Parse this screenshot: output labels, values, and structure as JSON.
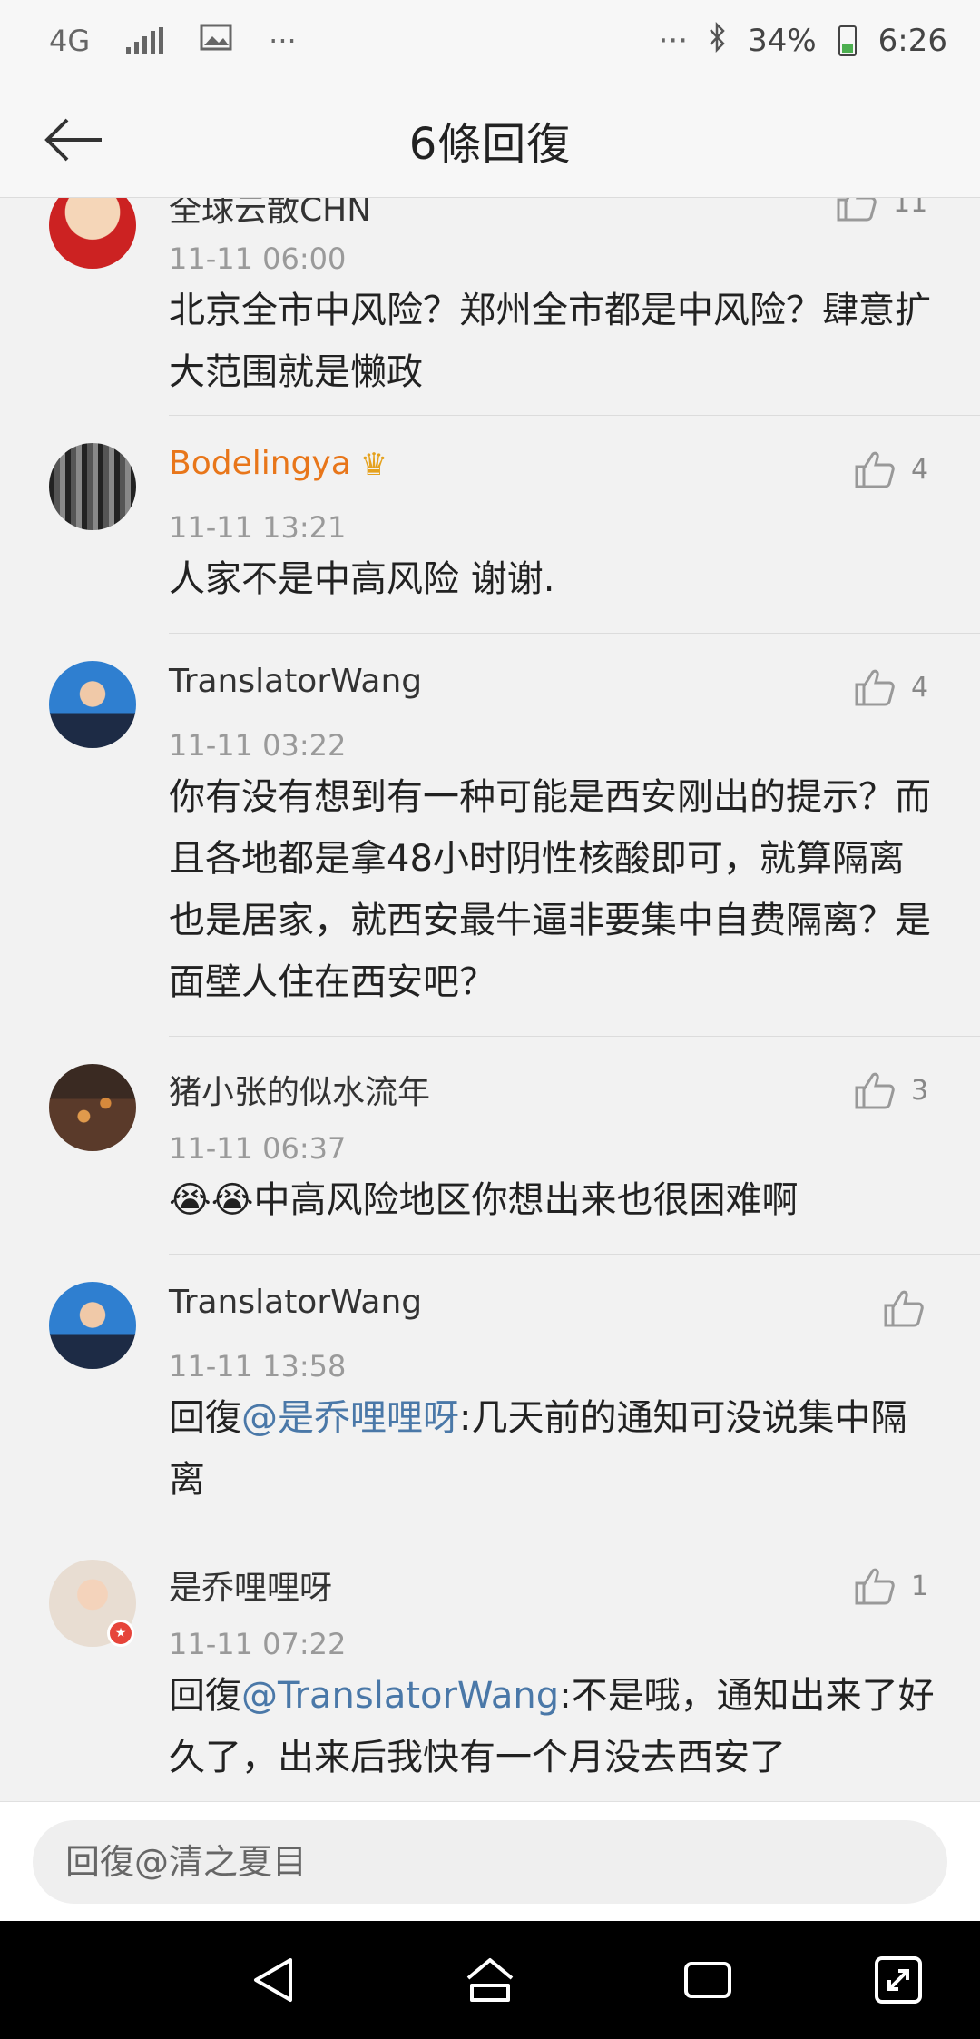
{
  "status_bar": {
    "network": "4G",
    "more": "···",
    "right_more": "···",
    "battery": "34%",
    "time": "6:26"
  },
  "header": {
    "title": "6條回復"
  },
  "comments": [
    {
      "username": "全球云散CHN",
      "time": "11-11 06:00",
      "content": "北京全市中风险？郑州全市都是中风险？肆意扩大范围就是懒政",
      "likes": "11"
    },
    {
      "username": "Bodelingya",
      "time": "11-11 13:21",
      "content": "人家不是中高风险 谢谢.",
      "likes": "4"
    },
    {
      "username": "TranslatorWang",
      "time": "11-11 03:22",
      "content": "你有没有想到有一种可能是西安刚出的提示？而且各地都是拿48小时阴性核酸即可，就算隔离也是居家，就西安最牛逼非要集中自费隔离？是面壁人住在西安吧？",
      "likes": "4"
    },
    {
      "username": "猪小张的似水流年",
      "time": "11-11 06:37",
      "content": "😭😭中高风险地区你想出来也很困难啊",
      "likes": "3"
    },
    {
      "username": "TranslatorWang",
      "time": "11-11 13:58",
      "reply_prefix": "回復",
      "mention": "@是乔哩哩呀",
      "content": ":几天前的通知可没说集中隔离",
      "likes": ""
    },
    {
      "username": "是乔哩哩呀",
      "time": "11-11 07:22",
      "reply_prefix": "回復",
      "mention": "@TranslatorWang",
      "content": ":不是哦，通知出来了好久了，出来后我快有一个月没去西安了",
      "likes": "1"
    }
  ],
  "reply_bar": {
    "placeholder": "回復@清之夏目"
  },
  "colors": {
    "vip_name": "#e8761a",
    "mention": "#4a78a8",
    "meta_gray": "#9a9a9a"
  },
  "icons": [
    "back-arrow-icon",
    "thumb-up-icon",
    "crown-icon",
    "nav-back-icon",
    "nav-home-icon",
    "nav-recents-icon",
    "nav-screenshot-icon"
  ]
}
